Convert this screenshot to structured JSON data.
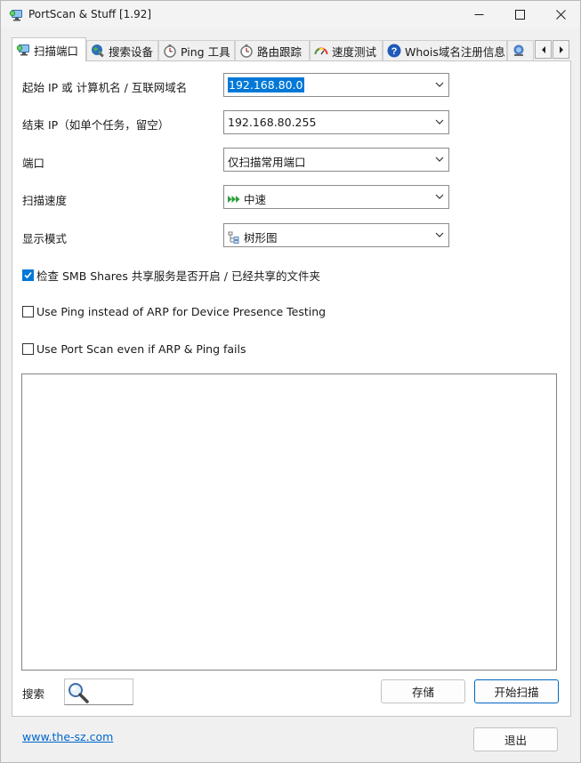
{
  "window": {
    "title": "PortScan & Stuff [1.92]",
    "icon": "network-monitor-icon"
  },
  "tabs": [
    {
      "label": "扫描端口",
      "icon": "network-monitor-icon",
      "active": true
    },
    {
      "label": "搜索设备",
      "icon": "globe-search-icon",
      "active": false
    },
    {
      "label": "Ping 工具",
      "icon": "stopwatch-icon",
      "active": false
    },
    {
      "label": "路由跟踪",
      "icon": "stopwatch-icon",
      "active": false
    },
    {
      "label": "速度测试",
      "icon": "speedometer-icon",
      "active": false
    },
    {
      "label": "Whois域名注册信息",
      "icon": "help-circle-icon",
      "active": false
    }
  ],
  "form": {
    "start_ip": {
      "label": "起始 IP 或 计算机名 / 互联网域名",
      "value": "192.168.80.0"
    },
    "end_ip": {
      "label": "结束 IP（如单个任务，留空）",
      "value": "192.168.80.255"
    },
    "port": {
      "label": "端口",
      "value": "仅扫描常用端口"
    },
    "speed": {
      "label": "扫描速度",
      "value": "中速",
      "icon": "fast-forward-icon"
    },
    "display": {
      "label": "显示模式",
      "value": "树形图",
      "icon": "tree-view-icon"
    }
  },
  "options": [
    {
      "label": "检查 SMB Shares 共享服务是否开启 / 已经共享的文件夹",
      "checked": true
    },
    {
      "label": "Use Ping instead of ARP for Device Presence Testing",
      "checked": false
    },
    {
      "label": "Use Port Scan even if ARP & Ping fails",
      "checked": false
    }
  ],
  "bottom": {
    "search_label": "搜索",
    "save_button": "存储",
    "start_button": "开始扫描",
    "exit_button": "退出",
    "website": "www.the-sz.com"
  },
  "colors": {
    "accent": "#0078d7",
    "link": "#0066cc"
  }
}
